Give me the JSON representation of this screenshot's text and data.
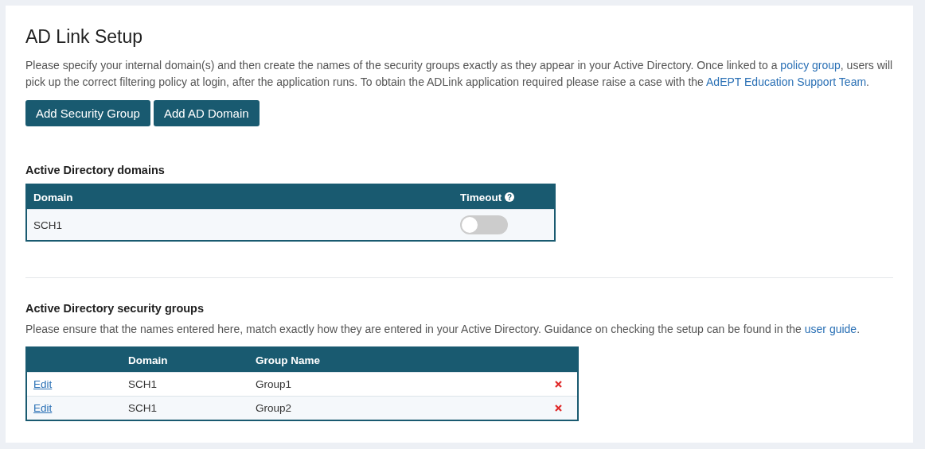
{
  "title": "AD Link Setup",
  "intro": [
    {
      "kind": "text",
      "text": "Please specify your internal domain(s) and then create the names of the security groups exactly as they appear in your Active Directory. Once linked to a "
    },
    {
      "kind": "link",
      "text": "policy group"
    },
    {
      "kind": "text",
      "text": ", users will pick up the correct filtering policy at login, after the application runs. To obtain the ADLink application required please raise a case with the "
    },
    {
      "kind": "link",
      "text": "AdEPT Education Support Team"
    },
    {
      "kind": "text",
      "text": "."
    }
  ],
  "buttons": [
    "Add Security Group",
    "Add AD Domain"
  ],
  "domains": {
    "heading": "Active Directory domains",
    "columns": [
      "Domain",
      "Timeout"
    ],
    "help_mark": "?",
    "rows": [
      {
        "domain": "SCH1",
        "timeout_on": false
      }
    ]
  },
  "groups": {
    "heading": "Active Directory security groups",
    "note": [
      {
        "kind": "text",
        "text": "Please ensure that the names entered here, match exactly how they are entered in your Active Directory. Guidance on checking the setup can be found in the "
      },
      {
        "kind": "link",
        "text": "user guide"
      },
      {
        "kind": "text",
        "text": "."
      }
    ],
    "columns": [
      "Domain",
      "Group Name"
    ],
    "rows": [
      {
        "action": "Edit",
        "domain": "SCH1",
        "group": "Group1"
      },
      {
        "action": "Edit",
        "domain": "SCH1",
        "group": "Group2"
      }
    ]
  }
}
